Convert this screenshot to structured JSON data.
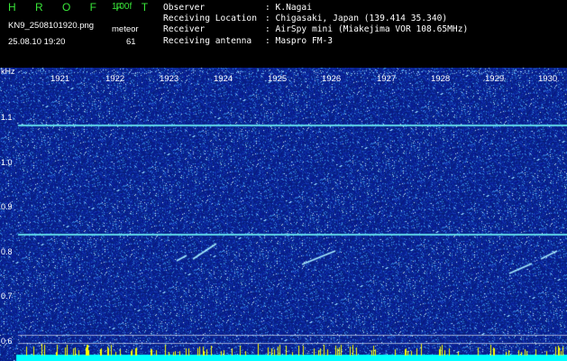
{
  "header": {
    "brand": "H R O F F T",
    "version": "1.00f",
    "filename": "KN9_2508101920.png",
    "datetime": "25.08.10 19:20",
    "meteor_label": "meteor",
    "meteor_count": "61",
    "info": [
      {
        "key": "Observer",
        "value": ": K.Nagai"
      },
      {
        "key": "Receiving Location",
        "value": ": Chigasaki, Japan (139.414 35.340)"
      },
      {
        "key": "Receiver",
        "value": ": AirSpy mini (Miakejima VOR 108.65MHz)"
      },
      {
        "key": "Receiving antenna",
        "value": ": Maspro FM-3"
      }
    ]
  },
  "axis": {
    "unit": "kHz",
    "y_ticks": [
      "1.1",
      "1.0",
      "0.9",
      "0.8",
      "0.7",
      "0.6"
    ],
    "time_ticks": [
      "1921",
      "1922",
      "1923",
      "1924",
      "1925",
      "1926",
      "1927",
      "1928",
      "1929",
      "1930"
    ]
  },
  "colors": {
    "background_noise": "#0a1a8c",
    "carrier_line": "#5fd7e8",
    "brand": "#39e639",
    "baseline": "#00ffff",
    "spikes": "#ffff00"
  }
}
